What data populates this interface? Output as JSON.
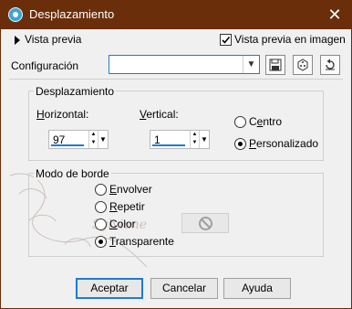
{
  "window": {
    "title": "Desplazamiento",
    "close_glyph": "✕"
  },
  "preview": {
    "expander_label": "Vista previa",
    "checkbox_label": "Vista previa en imagen",
    "checkbox_checked": true
  },
  "config": {
    "label": "Configuración",
    "combo_value": ""
  },
  "displacement": {
    "group_title": "Desplazamiento",
    "horizontal_label": "Horizontal:",
    "horizontal_value": "97",
    "vertical_label": "Vertical:",
    "vertical_value": "1",
    "center_label": "Centro",
    "custom_label": "Personalizado",
    "selected": "custom"
  },
  "border_mode": {
    "group_title": "Modo de borde",
    "options": [
      "Envolver",
      "Repetir",
      "Color",
      "Transparente"
    ],
    "selected": "Transparente"
  },
  "watermark_text": "Sylviane",
  "buttons": {
    "accept": "Aceptar",
    "cancel": "Cancelar",
    "help": "Ayuda"
  },
  "colors": {
    "titlebar": "#6b2e0a",
    "accent": "#1e7bd4",
    "title_icon": "#3aa6d8"
  }
}
